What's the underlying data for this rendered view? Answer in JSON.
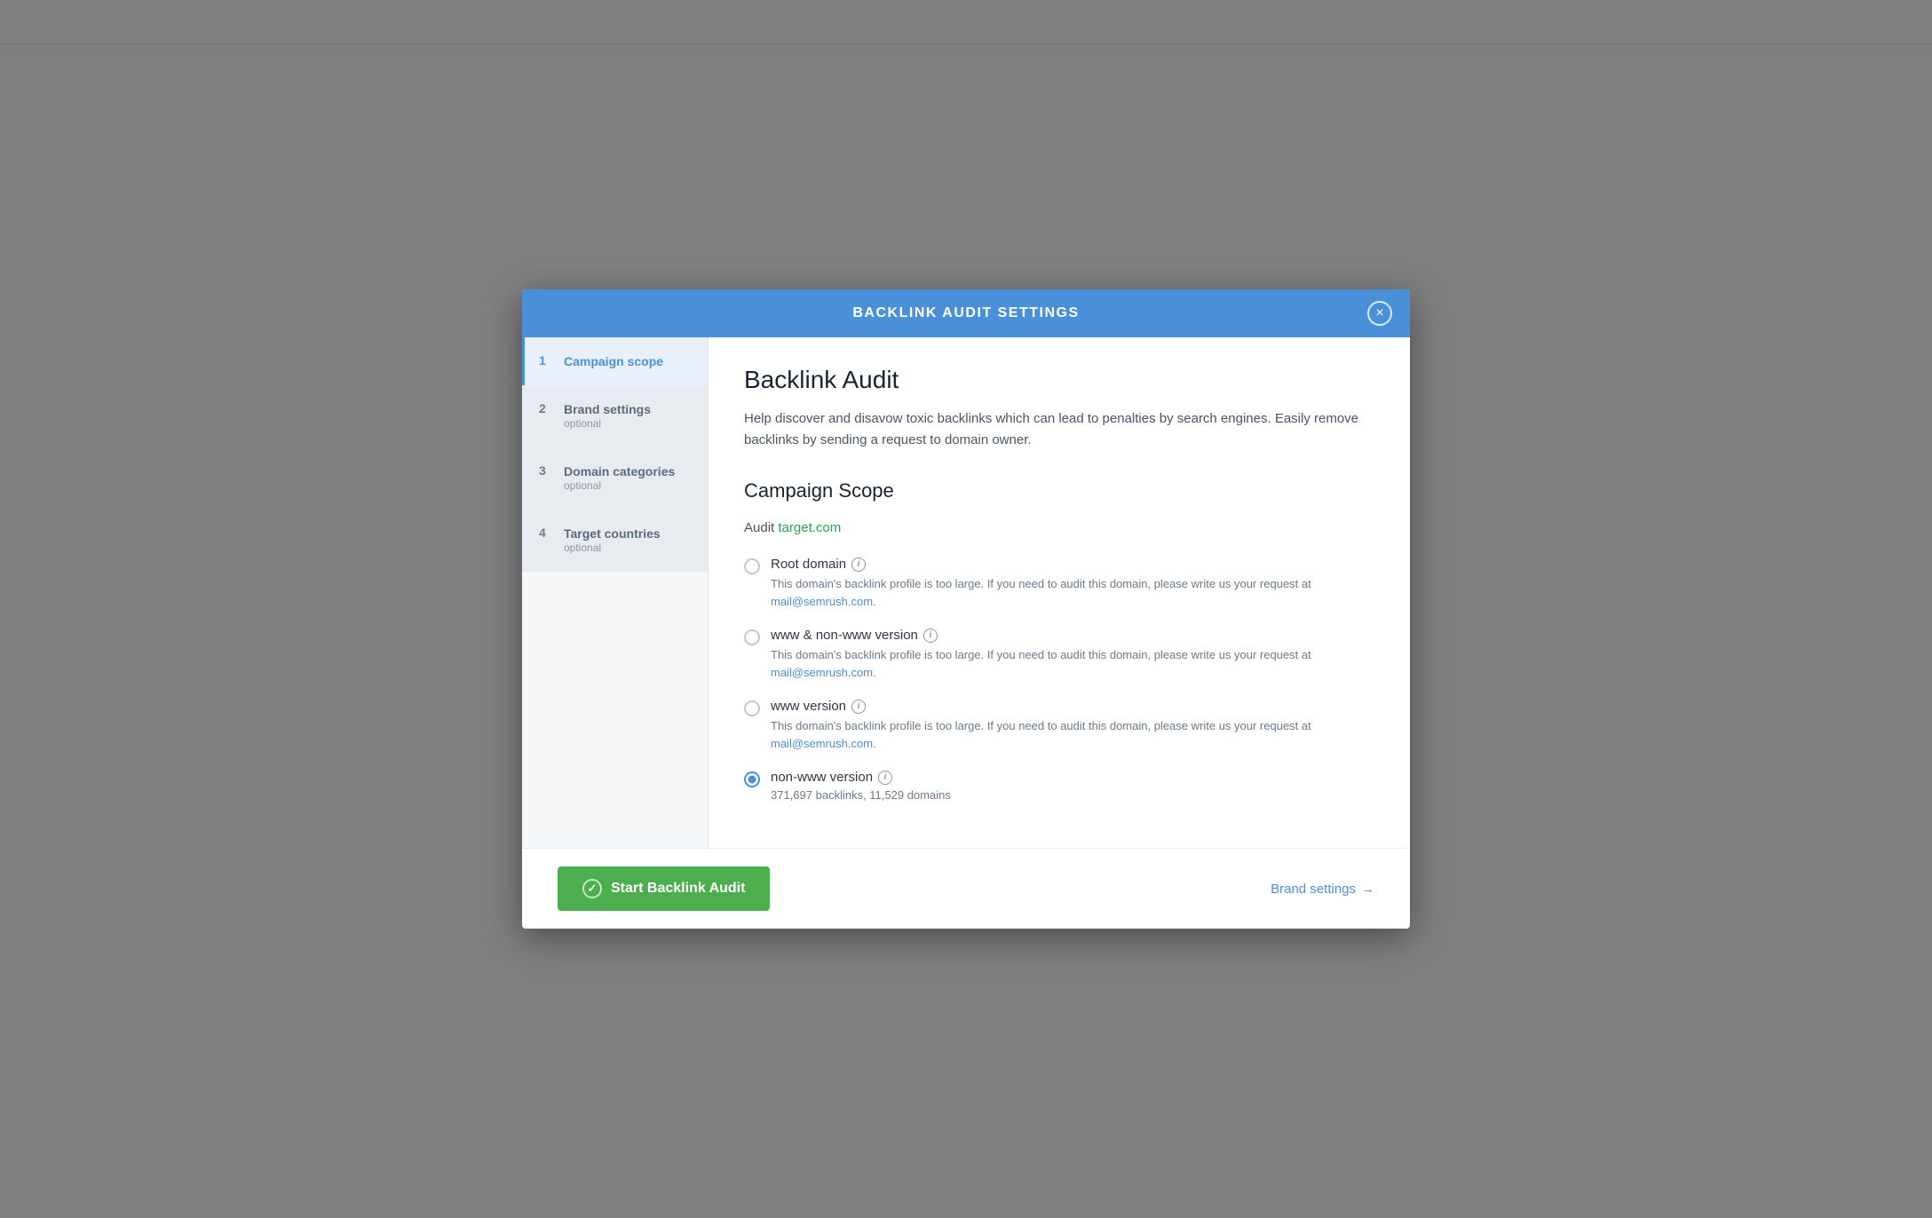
{
  "modal": {
    "header": {
      "title": "BACKLINK AUDIT SETTINGS",
      "close_label": "×"
    },
    "sidebar": {
      "items": [
        {
          "number": "1",
          "label": "Campaign scope",
          "optional_label": "",
          "state": "active"
        },
        {
          "number": "2",
          "label": "Brand settings",
          "optional_label": "optional",
          "state": "inactive"
        },
        {
          "number": "3",
          "label": "Domain categories",
          "optional_label": "optional",
          "state": "inactive"
        },
        {
          "number": "4",
          "label": "Target countries",
          "optional_label": "optional",
          "state": "inactive"
        }
      ]
    },
    "main": {
      "page_title": "Backlink Audit",
      "page_description": "Help discover and disavow toxic backlinks which can lead to penalties by search engines. Easily remove backlinks by sending a request to domain owner.",
      "section_title": "Campaign Scope",
      "audit_label": "Audit",
      "audit_domain": "target.com",
      "radio_options": [
        {
          "id": "root-domain",
          "label": "Root domain",
          "has_info": true,
          "description": "This domain's backlink profile is too large. If you need to audit this domain, please write us your request at",
          "email_link": "mail@semrush.com",
          "selected": false
        },
        {
          "id": "www-non-www",
          "label": "www & non-www version",
          "has_info": true,
          "description": "This domain's backlink profile is too large. If you need to audit this domain, please write us your request at",
          "email_link": "mail@semrush.com",
          "selected": false
        },
        {
          "id": "www-version",
          "label": "www version",
          "has_info": true,
          "description": "This domain's backlink profile is too large. If you need to audit this domain, please write us your request at",
          "email_link": "mail@semrush.com",
          "selected": false
        },
        {
          "id": "non-www-version",
          "label": "non-www version",
          "has_info": true,
          "count_label": "371,697 backlinks, 11,529 domains",
          "description": null,
          "selected": true
        }
      ]
    },
    "footer": {
      "start_button_label": "Start Backlink Audit",
      "brand_settings_label": "Brand settings",
      "brand_settings_arrow": "→"
    }
  }
}
